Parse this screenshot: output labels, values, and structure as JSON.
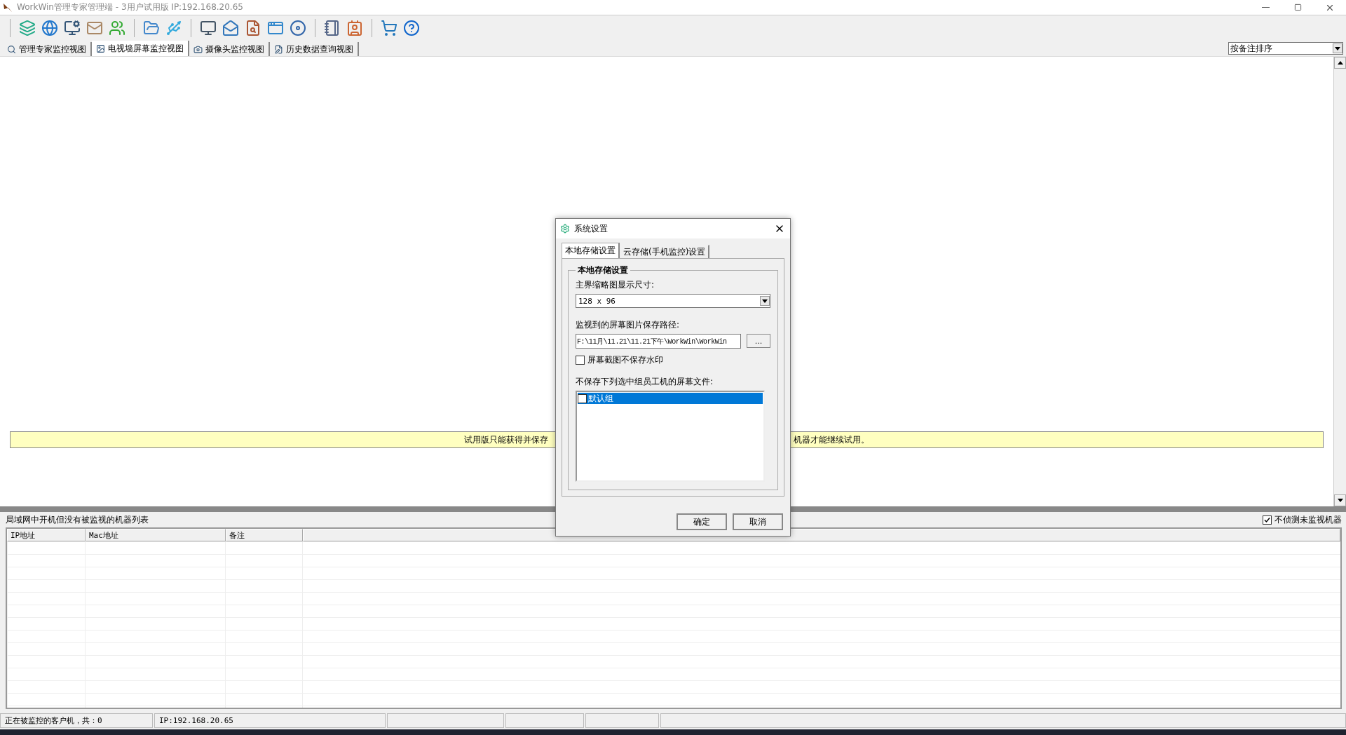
{
  "window": {
    "title": "WorkWin管理专家管理端 - 3用户试用版 IP:192.168.20.65"
  },
  "view_tabs": [
    {
      "label": "管理专家监控视图",
      "selected": false
    },
    {
      "label": "电视墙屏幕监控视图",
      "selected": true
    },
    {
      "label": "摄像头监控视图",
      "selected": false
    },
    {
      "label": "历史数据查询视图",
      "selected": false
    }
  ],
  "sort_select": {
    "value": "按备注排序"
  },
  "banner": {
    "text_left": "试用版只能获得并保存",
    "text_right": "机器才能继续试用。"
  },
  "unmonitored_panel": {
    "title": "局域网中开机但没有被监视的机器列表",
    "option": {
      "label": "不侦测未监视机器",
      "checked": true
    },
    "columns": [
      "IP地址",
      "Mac地址",
      "备注"
    ]
  },
  "status_bar": [
    "正在被监控的客户机，共：0",
    "IP:192.168.20.65"
  ],
  "dialog": {
    "title": "系统设置",
    "tabs": [
      {
        "label": "本地存储设置",
        "selected": true
      },
      {
        "label": "云存储(手机监控)设置",
        "selected": false
      }
    ],
    "group_title": "本地存储设置",
    "thumb_label": "主界缩略图显示尺寸:",
    "thumb_value": "128 x 96",
    "path_label": "监视到的屏幕图片保存路径:",
    "path_value": "F:\\11月\\11.21\\11.21下午\\WorkWin\\WorkWin",
    "browse": "...",
    "watermark": {
      "label": "屏幕截图不保存水印",
      "checked": false
    },
    "exclude_label": "不保存下列选中组员工机的屏幕文件:",
    "groups": [
      {
        "label": "默认组",
        "checked": false,
        "selected": true
      }
    ],
    "buttons": [
      "确定",
      "取消"
    ]
  }
}
